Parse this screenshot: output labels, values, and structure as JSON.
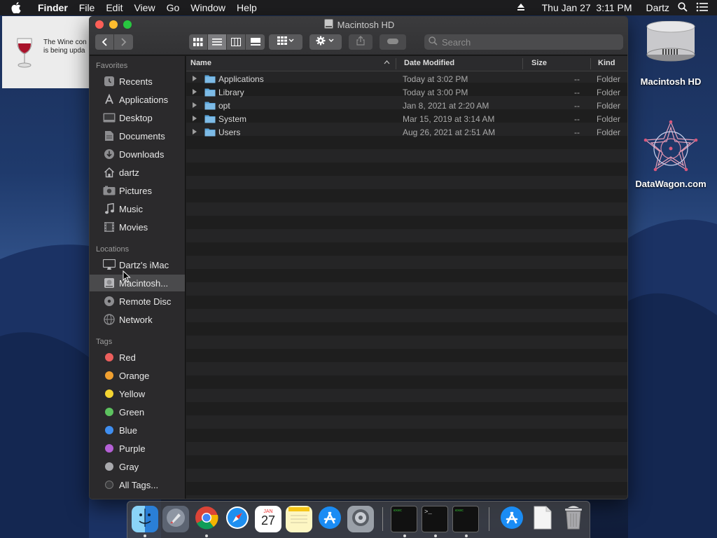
{
  "menubar": {
    "app_name": "Finder",
    "menus": [
      "File",
      "Edit",
      "View",
      "Go",
      "Window",
      "Help"
    ],
    "clock": "Thu Jan 27  3:11 PM",
    "user": "Dartz"
  },
  "wine_dialog": {
    "message_line1": "The Wine con",
    "message_line2": "is being upda"
  },
  "window": {
    "title": "Macintosh HD",
    "search_placeholder": "Search",
    "sidebar": {
      "favorites_header": "Favorites",
      "favorites": [
        {
          "label": "Recents",
          "icon": "recents-icon"
        },
        {
          "label": "Applications",
          "icon": "applications-icon"
        },
        {
          "label": "Desktop",
          "icon": "desktop-icon"
        },
        {
          "label": "Documents",
          "icon": "documents-icon"
        },
        {
          "label": "Downloads",
          "icon": "downloads-icon"
        },
        {
          "label": "dartz",
          "icon": "home-icon"
        },
        {
          "label": "Pictures",
          "icon": "pictures-icon"
        },
        {
          "label": "Music",
          "icon": "music-icon"
        },
        {
          "label": "Movies",
          "icon": "movies-icon"
        }
      ],
      "locations_header": "Locations",
      "locations": [
        {
          "label": "Dartz's iMac",
          "icon": "imac-icon"
        },
        {
          "label": "Macintosh...",
          "icon": "hard-drive-icon",
          "selected": true
        },
        {
          "label": "Remote Disc",
          "icon": "disc-icon"
        },
        {
          "label": "Network",
          "icon": "network-icon"
        }
      ],
      "tags_header": "Tags",
      "tags": [
        {
          "label": "Red",
          "color": "#ec5f5d"
        },
        {
          "label": "Orange",
          "color": "#f0a030"
        },
        {
          "label": "Yellow",
          "color": "#f5d532"
        },
        {
          "label": "Green",
          "color": "#5dc25f"
        },
        {
          "label": "Blue",
          "color": "#3f8ef0"
        },
        {
          "label": "Purple",
          "color": "#b560d6"
        },
        {
          "label": "Gray",
          "color": "#a9a9ad"
        },
        {
          "label": "All Tags...",
          "color": "#3a3a3c"
        }
      ]
    },
    "columns": {
      "name": "Name",
      "date": "Date Modified",
      "size": "Size",
      "kind": "Kind"
    },
    "files": [
      {
        "name": "Applications",
        "date": "Today at 3:02 PM",
        "size": "--",
        "kind": "Folder"
      },
      {
        "name": "Library",
        "date": "Today at 3:00 PM",
        "size": "--",
        "kind": "Folder"
      },
      {
        "name": "opt",
        "date": "Jan 8, 2021 at 2:20 AM",
        "size": "--",
        "kind": "Folder"
      },
      {
        "name": "System",
        "date": "Mar 15, 2019 at 3:14 AM",
        "size": "--",
        "kind": "Folder"
      },
      {
        "name": "Users",
        "date": "Aug 26, 2021 at 2:51 AM",
        "size": "--",
        "kind": "Folder"
      }
    ]
  },
  "desktop": {
    "hd_label": "Macintosh HD",
    "datawagon_label": "DataWagon.com"
  },
  "dock": {
    "calendar_month": "JAN",
    "calendar_day": "27",
    "terminal_text": "exec",
    "terminal_prompt": ">_"
  },
  "colors": {
    "accent": "#3f8ef0",
    "window_bg": "#1e1e1e",
    "sidebar_bg": "#2b2a2c"
  }
}
